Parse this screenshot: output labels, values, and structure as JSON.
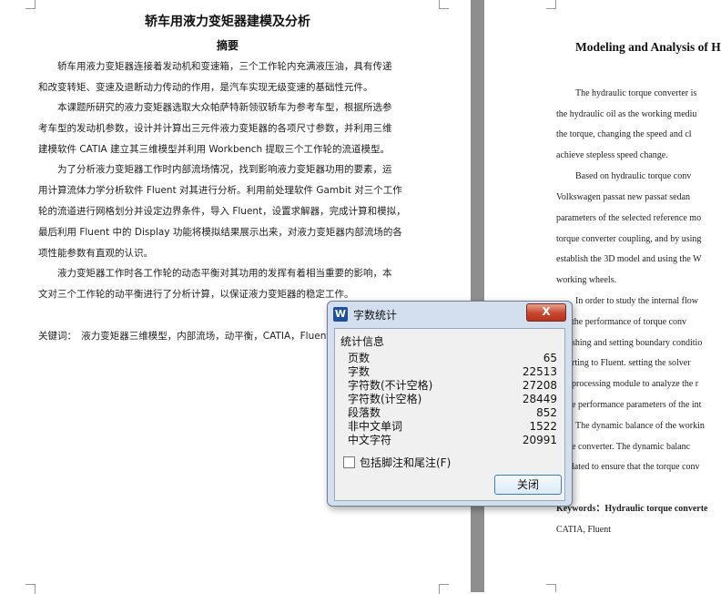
{
  "left_page": {
    "title": "轿车用液力变矩器建模及分析",
    "abstract_heading": "摘要",
    "lines": [
      "　　轿车用液力变矩器连接着发动机和变速箱，三个工作轮内充满液压油，具有传递",
      "和改变转矩、变速及退断动力传动的作用，是汽车实现无级变速的基础性元件。",
      "　　本课题所研究的液力变矩器选取大众帕萨特新领驭轿车为参考车型，根据所选参",
      "考车型的发动机参数，设计并计算出三元件液力变矩器的各项尺寸参数，并利用三维",
      "建模软件 CATIA 建立其三维模型并利用 Workbench 提取三个工作轮的流道模型。",
      "　　为了分析液力变矩器工作时内部流场情况，找到影响液力变矩器功用的要素，运",
      "用计算流体力学分析软件 Fluent 对其进行分析。利用前处理软件 Gambit 对三个工作",
      "轮的流道进行网格划分并设定边界条件，导入 Fluent，设置求解器，完成计算和模拟，",
      "最后利用 Fluent 中的 Display 功能将模拟结果展示出来，对液力变矩器内部流场的各",
      "项性能参数有直观的认识。",
      "　　液力变矩器工作时各工作轮的动态平衡对其功用的发挥有着相当重要的影响，本",
      "文对三个工作轮的动平衡进行了分析计算，以保证液力变矩器的稳定工作。"
    ],
    "keywords": "关键词：　液力变矩器三维模型，内部流场，动平衡，CATIA，Fluent"
  },
  "right_page": {
    "title": "Modeling and Analysis of H",
    "lines": [
      "The hydraulic torque converter is",
      "the hydraulic oil as the working mediu",
      "the torque, changing the speed and cl",
      "achieve stepless speed change.",
      "Based on hydraulic torque conv",
      "Volkswagen passat new passat sedan",
      "parameters of the selected reference mo",
      "torque converter coupling, and by using",
      "establish the 3D model and using the W",
      "working wheels.",
      "In order to study the internal flow",
      "the performance of torque conv",
      "shing and setting boundary conditio",
      "rting to Fluent. setting the solver",
      "processing module to analyze the r",
      "e performance parameters of the int",
      "The dynamic balance of the workin",
      "e converter. The dynamic balanc",
      "lated to ensure that the torque conv"
    ],
    "keywords": "Keywords：Hydraulic torque converte",
    "keywords2": "CATIA, Fluent"
  },
  "dialog": {
    "app_icon": "W",
    "title": "字数统计",
    "close_label": "X",
    "section_label": "统计信息",
    "stats": [
      {
        "label": "页数",
        "value": "65"
      },
      {
        "label": "字数",
        "value": "22513"
      },
      {
        "label": "字符数(不计空格)",
        "value": "27208"
      },
      {
        "label": "字符数(计空格)",
        "value": "28449"
      },
      {
        "label": "段落数",
        "value": "852"
      },
      {
        "label": "非中文单词",
        "value": "1522"
      },
      {
        "label": "中文字符",
        "value": "20991"
      }
    ],
    "checkbox_label": "包括脚注和尾注(F)",
    "checkbox_checked": false,
    "button_label": "关闭"
  },
  "colors": {
    "gutter": "#8e8e8e",
    "dialog_frame": "#d3dfee",
    "close_button": "#c6452e",
    "app_icon": "#1d4f9a"
  }
}
